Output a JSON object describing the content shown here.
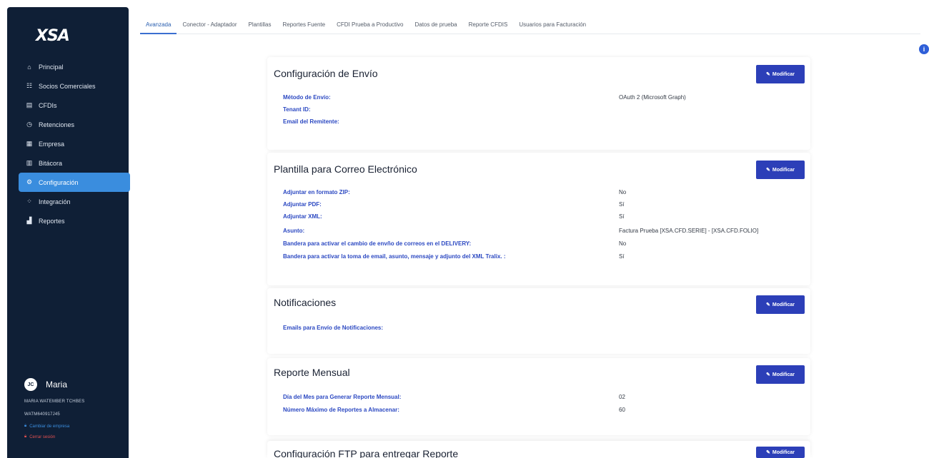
{
  "sidebar": {
    "logo": "XSA",
    "items": [
      {
        "label": "Principal",
        "icon": "home-icon",
        "glyph": "⌂",
        "active": false
      },
      {
        "label": "Socios Comerciales",
        "icon": "partners-icon",
        "glyph": "☷",
        "active": false
      },
      {
        "label": "CFDIs",
        "icon": "document-icon",
        "glyph": "▤",
        "active": false
      },
      {
        "label": "Retenciones",
        "icon": "clock-icon",
        "glyph": "◷",
        "active": false
      },
      {
        "label": "Empresa",
        "icon": "building-icon",
        "glyph": "▦",
        "active": false
      },
      {
        "label": "Bitácora",
        "icon": "book-icon",
        "glyph": "▥",
        "active": false
      },
      {
        "label": "Configuración",
        "icon": "gear-icon",
        "glyph": "⚙",
        "active": true
      },
      {
        "label": "Integración",
        "icon": "integration-icon",
        "glyph": "⁘",
        "active": false
      },
      {
        "label": "Reportes",
        "icon": "chart-icon",
        "glyph": "▟",
        "active": false
      }
    ],
    "user": {
      "initials": "JC",
      "name": "Maria",
      "company": "MARIA WATEMBER TCHBES",
      "rfc": "WATM640917J45",
      "change_company": "Cambiar de empresa",
      "logout": "Cerrar sesión"
    }
  },
  "tabs": [
    {
      "label": "Avanzada",
      "active": true
    },
    {
      "label": "Conector - Adaptador",
      "active": false
    },
    {
      "label": "Plantillas",
      "active": false
    },
    {
      "label": "Reportes Fuente",
      "active": false
    },
    {
      "label": "CFDI Prueba a Productivo",
      "active": false
    },
    {
      "label": "Datos de prueba",
      "active": false
    },
    {
      "label": "Reporte CFDIS",
      "active": false
    },
    {
      "label": "Usuarios para Facturación",
      "active": false
    }
  ],
  "info_icon": "i",
  "modify_label": "Modificar",
  "cards": [
    {
      "title": "Configuración de Envío",
      "rows": [
        {
          "label": "Método de Envío:",
          "value": "OAuth 2 (Microsoft Graph)"
        },
        {
          "label": "Tenant ID:",
          "value": ""
        },
        {
          "label": "Email del Remitente:",
          "value": ""
        }
      ]
    },
    {
      "title": "Plantilla para Correo Electrónico",
      "rows": [
        {
          "label": "Adjuntar en formato ZIP:",
          "value": "No"
        },
        {
          "label": "Adjuntar PDF:",
          "value": "Sí"
        },
        {
          "label": "Adjuntar XML:",
          "value": "Sí"
        },
        {
          "label": "Asunto:",
          "value": "Factura Prueba [XSA.CFD.SERIE] - [XSA.CFD.FOLIO]"
        },
        {
          "label": "Bandera para activar el cambio de envño de correos en el DELIVERY:",
          "value": "No"
        },
        {
          "label": "Bandera para activar la toma de email, asunto, mensaje y adjunto del XML Tralix. :",
          "value": "Sí"
        }
      ]
    },
    {
      "title": "Notificaciones",
      "rows": [
        {
          "label": "Emails para Envío de Notificaciones:",
          "value": ""
        }
      ]
    },
    {
      "title": "Reporte Mensual",
      "rows": [
        {
          "label": "Día del Mes para Generar Reporte Mensual:",
          "value": "02"
        },
        {
          "label": "Número Máximo de Reportes a Almacenar:",
          "value": "60"
        }
      ]
    },
    {
      "title": "Configuración FTP para entregar Reporte",
      "rows": []
    }
  ],
  "colors": {
    "sidebar_bg": "#0f1f36",
    "active_nav": "#3a8dde",
    "label_blue": "#2c49c2",
    "button_blue": "#2c3fb8"
  }
}
